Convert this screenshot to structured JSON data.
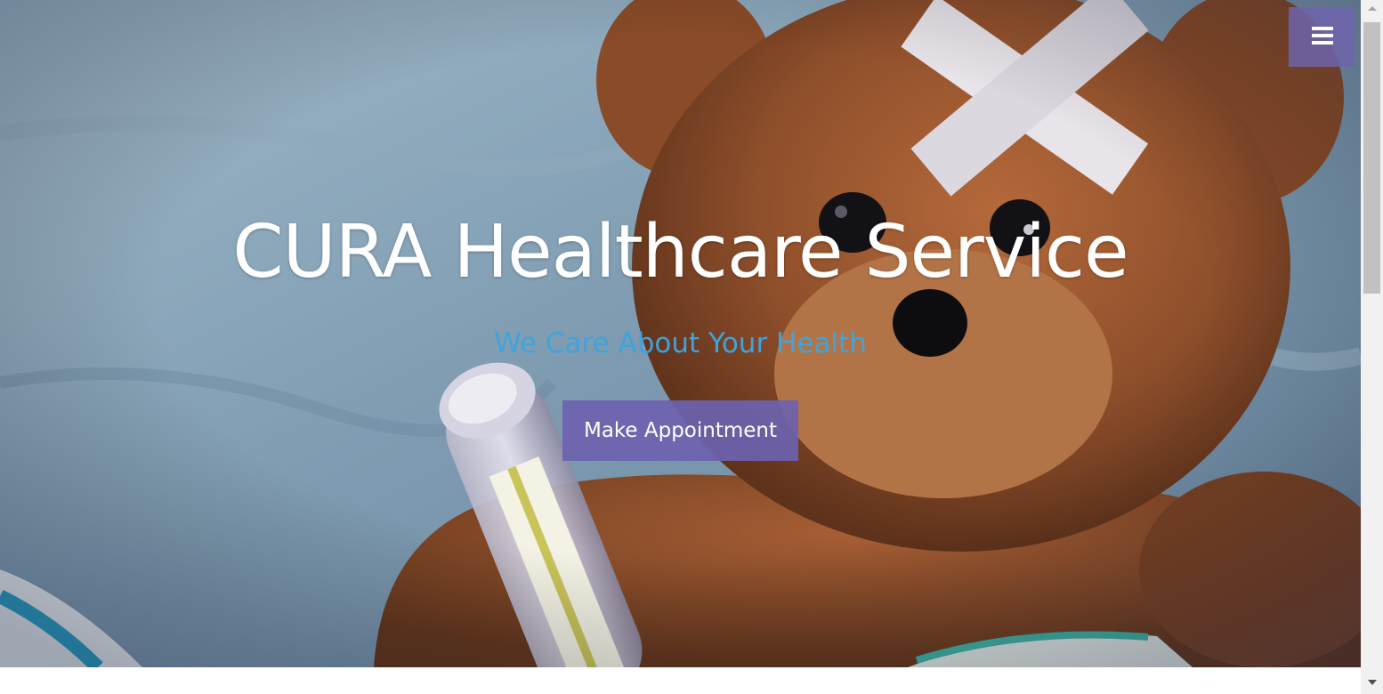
{
  "header": {
    "menu_toggle_icon": "hamburger-menu-icon"
  },
  "hero": {
    "title": "CURA Healthcare Service",
    "subtitle": "We Care About Your Health",
    "cta_label": "Make Appointment",
    "background_image": "teddy bear with bandage and thermometer"
  },
  "colors": {
    "brand_purple": "#6c62ae",
    "subtitle_blue": "#3fa3dd",
    "title_white": "#ffffff"
  }
}
